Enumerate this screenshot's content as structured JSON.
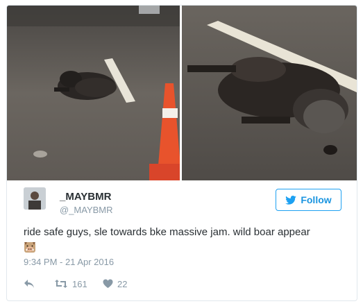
{
  "tweet": {
    "display_name": "_MAYBMR",
    "handle": "@_MAYBMR",
    "follow_label": "Follow",
    "text": "ride safe guys, sle towards bke massive jam. wild boar appear",
    "emoji_icon": "boar-face-icon",
    "timestamp": "9:34 PM - 21 Apr 2016",
    "retweet_count": "161",
    "like_count": "22"
  },
  "colors": {
    "accent": "#1da1f2",
    "muted": "#8899a6",
    "text": "#292f33",
    "cone": "#e8532c"
  },
  "media": {
    "left_photo": "boar on road with traffic cone",
    "right_photo": "close-up of boar on road"
  }
}
